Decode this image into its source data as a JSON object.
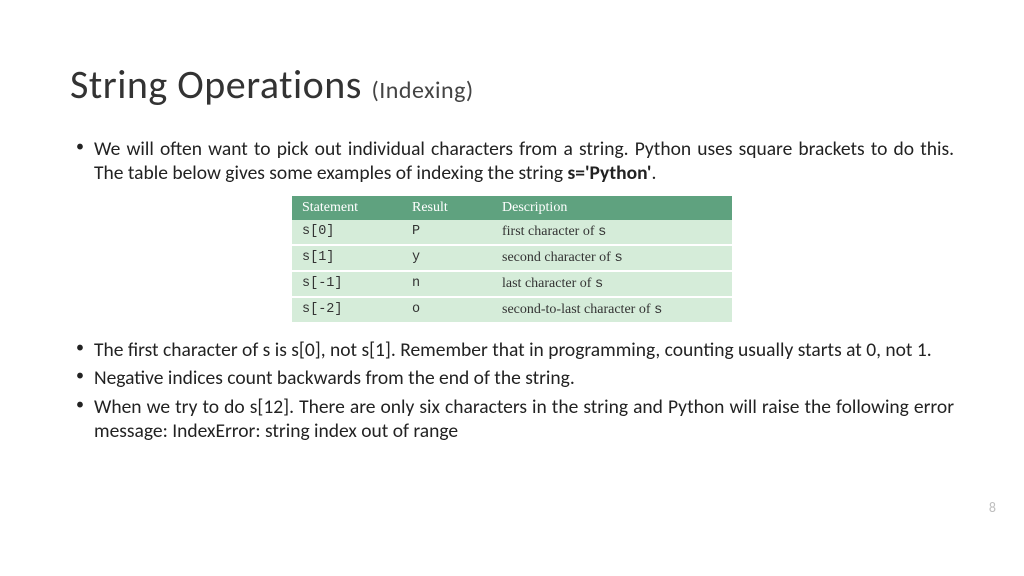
{
  "title_main": "String Operations",
  "title_sub": "(Indexing)",
  "bullet1_pre": "We will often want to pick out individual characters from a string. Python uses square brackets to do this. The table below gives some examples of indexing the string ",
  "bullet1_bold": "s='Python'",
  "bullet1_post": ".",
  "table": {
    "headers": [
      "Statement",
      "Result",
      "Description"
    ],
    "rows": [
      {
        "stmt": "s[0]",
        "result": "P",
        "desc_pre": "first character of ",
        "desc_code": "s"
      },
      {
        "stmt": "s[1]",
        "result": "y",
        "desc_pre": "second character of ",
        "desc_code": "s"
      },
      {
        "stmt": "s[-1]",
        "result": "n",
        "desc_pre": "last character of ",
        "desc_code": "s"
      },
      {
        "stmt": "s[-2]",
        "result": "o",
        "desc_pre": "second-to-last character of ",
        "desc_code": "s"
      }
    ]
  },
  "bullet2": "The first character of s is s[0], not s[1]. Remember that in programming, counting usually starts at 0, not 1.",
  "bullet3": "Negative indices count backwards from the end of the string.",
  "bullet4": "When we try to do s[12]. There are only six characters in the string and Python will raise the following error message: IndexError: string index out of range",
  "page_number": "8"
}
